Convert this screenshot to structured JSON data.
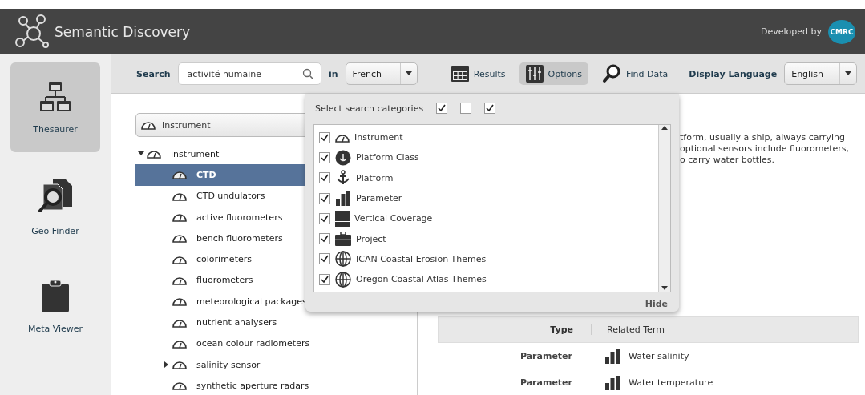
{
  "header": {
    "title": "Semantic Discovery",
    "developed_by": "Developed by",
    "logo_text": "CMRC"
  },
  "sidebar": {
    "items": [
      {
        "label": "Thesaurer",
        "kind": "thesaurus",
        "selected": true
      },
      {
        "label": "Geo Finder",
        "kind": "geo",
        "selected": false
      },
      {
        "label": "Meta Viewer",
        "kind": "meta",
        "selected": false
      }
    ]
  },
  "toolbar": {
    "search_label": "Search",
    "search_value": "activité humaine",
    "in_label": "in",
    "language": "French",
    "buttons": [
      {
        "label": "Results",
        "kind": "results",
        "selected": false
      },
      {
        "label": "Options",
        "kind": "options",
        "selected": true
      },
      {
        "label": "Find Data",
        "kind": "find",
        "selected": false
      }
    ],
    "display_language_label": "Display Language",
    "display_language": "English"
  },
  "category_select": {
    "value": "Instrument"
  },
  "tree": [
    {
      "label": "instrument",
      "expanded": true,
      "selected": false,
      "children": [
        {
          "label": "CTD",
          "selected": true
        },
        {
          "label": "CTD undulators",
          "selected": false
        },
        {
          "label": "active fluorometers",
          "selected": false
        },
        {
          "label": "bench fluorometers",
          "selected": false
        },
        {
          "label": "colorimeters",
          "selected": false
        },
        {
          "label": "fluorometers",
          "selected": false
        },
        {
          "label": "meteorological packages",
          "selected": false
        },
        {
          "label": "nutrient analysers",
          "selected": false
        },
        {
          "label": "ocean colour radiometers",
          "selected": false
        },
        {
          "label": "salinity sensor",
          "selected": false,
          "expanded": false
        },
        {
          "label": "synthetic aperture radars",
          "selected": false
        }
      ]
    }
  ],
  "description": [
    "tform, usually a ship, always carrying",
    "optional sensors include fluorometers,",
    "o carry water bottles."
  ],
  "options_popup": {
    "title": "Select search categories",
    "header_checks": [
      true,
      false,
      true
    ],
    "categories": [
      {
        "label": "Instrument",
        "kind": "instrument",
        "checked": true
      },
      {
        "label": "Platform Class",
        "kind": "platform_class",
        "checked": true
      },
      {
        "label": "Platform",
        "kind": "platform",
        "checked": true
      },
      {
        "label": "Parameter",
        "kind": "parameter",
        "checked": true
      },
      {
        "label": "Vertical Coverage",
        "kind": "vertical",
        "checked": true
      },
      {
        "label": "Project",
        "kind": "project",
        "checked": true
      },
      {
        "label": "ICAN Coastal Erosion Themes",
        "kind": "globe",
        "checked": true
      },
      {
        "label": "Oregon Coastal Atlas Themes",
        "kind": "globe",
        "checked": true
      }
    ],
    "hide_label": "Hide"
  },
  "related_table": {
    "columns": [
      "Type",
      "Related Term"
    ],
    "rows": [
      {
        "type": "Parameter",
        "term": "Water salinity"
      },
      {
        "type": "Parameter",
        "term": "Water temperature"
      }
    ]
  }
}
